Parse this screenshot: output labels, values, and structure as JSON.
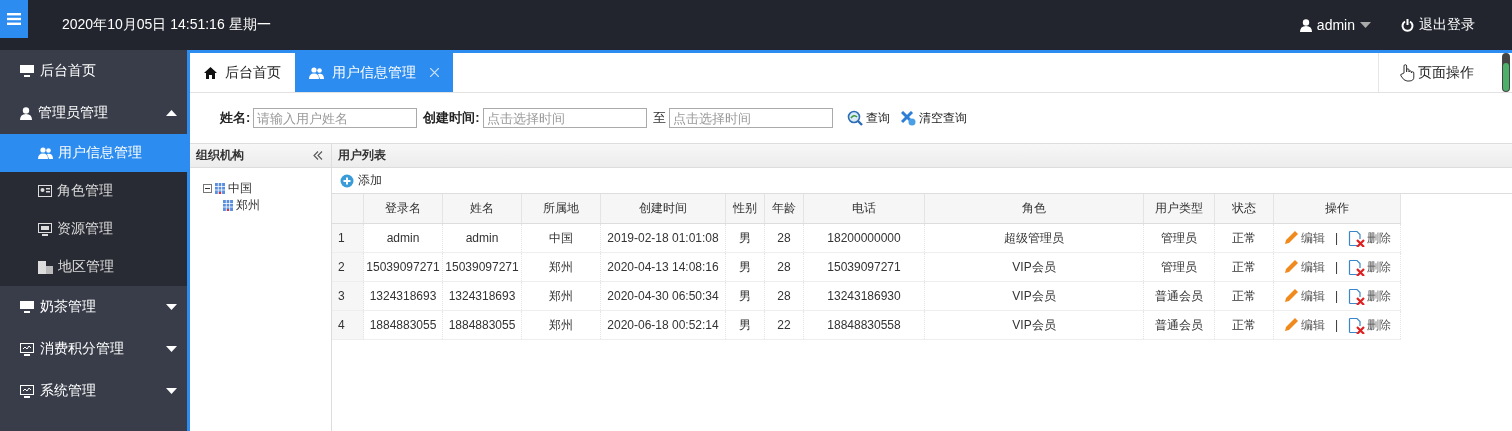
{
  "header": {
    "datetime": "2020年10月05日 14:51:16 星期一",
    "user": "admin",
    "logout": "退出登录"
  },
  "sidebar": {
    "items": [
      {
        "label": "后台首页",
        "selected": false
      },
      {
        "label": "管理员管理",
        "expanded": true,
        "selected": false,
        "children": [
          {
            "label": "用户信息管理",
            "selected": true
          },
          {
            "label": "角色管理",
            "selected": false
          },
          {
            "label": "资源管理",
            "selected": false
          },
          {
            "label": "地区管理",
            "selected": false
          }
        ]
      },
      {
        "label": "奶茶管理",
        "expanded": false,
        "selected": false
      },
      {
        "label": "消费积分管理",
        "expanded": false,
        "selected": false
      },
      {
        "label": "系统管理",
        "expanded": false,
        "selected": false
      }
    ]
  },
  "tabs": [
    {
      "label": "后台首页",
      "closable": false,
      "selected": false
    },
    {
      "label": "用户信息管理",
      "closable": true,
      "selected": true
    }
  ],
  "page_actions": "页面操作",
  "search": {
    "name_label": "姓名:",
    "name_placeholder": "请输入用户姓名",
    "time_label": "创建时间:",
    "start_placeholder": "点击选择时间",
    "to": "至",
    "end_placeholder": "点击选择时间",
    "query": "查询",
    "clear": "清空查询"
  },
  "org_panel": {
    "title": "组织机构",
    "tree": [
      {
        "label": "中国",
        "expanded": true,
        "children": [
          {
            "label": "郑州"
          }
        ]
      }
    ]
  },
  "user_panel": {
    "title": "用户列表",
    "add": "添加",
    "columns": [
      "登录名",
      "姓名",
      "所属地",
      "创建时间",
      "性别",
      "年龄",
      "电话",
      "角色",
      "用户类型",
      "状态",
      "操作"
    ],
    "rows": [
      {
        "index": "1",
        "cells": [
          "admin",
          "admin",
          "中国",
          "2019-02-18 01:01:08",
          "男",
          "28",
          "18200000000",
          "超级管理员",
          "管理员",
          "正常"
        ],
        "edit": "编辑",
        "sep": "|",
        "delete": "删除"
      },
      {
        "index": "2",
        "cells": [
          "15039097271",
          "15039097271",
          "郑州",
          "2020-04-13 14:08:16",
          "男",
          "28",
          "15039097271",
          "VIP会员",
          "管理员",
          "正常"
        ],
        "edit": "编辑",
        "sep": "|",
        "delete": "删除"
      },
      {
        "index": "3",
        "cells": [
          "1324318693",
          "1324318693",
          "郑州",
          "2020-04-30 06:50:34",
          "男",
          "28",
          "13243186930",
          "VIP会员",
          "普通会员",
          "正常"
        ],
        "edit": "编辑",
        "sep": "|",
        "delete": "删除"
      },
      {
        "index": "4",
        "cells": [
          "1884883055",
          "1884883055",
          "郑州",
          "2020-06-18 00:52:14",
          "男",
          "22",
          "18848830558",
          "VIP会员",
          "普通会员",
          "正常"
        ],
        "edit": "编辑",
        "sep": "|",
        "delete": "删除"
      }
    ]
  }
}
